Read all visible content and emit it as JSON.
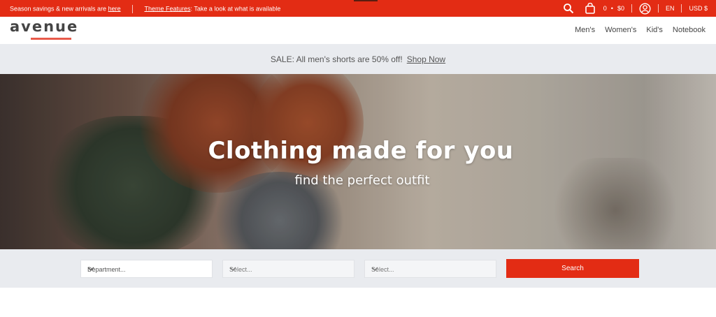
{
  "topbar": {
    "promo_text": "Season savings & new arrivals are ",
    "promo_link": "here",
    "features_link": "Theme Features",
    "features_text": ": Take a look at what is available",
    "cart_count": "0",
    "cart_dot": "•",
    "cart_total": "$0",
    "language": "EN",
    "currency": "USD $",
    "icons": [
      "search-icon",
      "cart-icon",
      "account-icon"
    ],
    "color": "#e32c14"
  },
  "header": {
    "logo": "avenue",
    "nav": [
      "Men's",
      "Women's",
      "Kid's",
      "Notebook"
    ]
  },
  "sale": {
    "text": "SALE: All men's shorts are 50% off!",
    "link": "Shop Now"
  },
  "hero": {
    "title": "Clothing made for you",
    "subtitle": "find the perfect outfit"
  },
  "search": {
    "department": "Department...",
    "select2": "Select...",
    "select3": "Select...",
    "button": "Search"
  }
}
